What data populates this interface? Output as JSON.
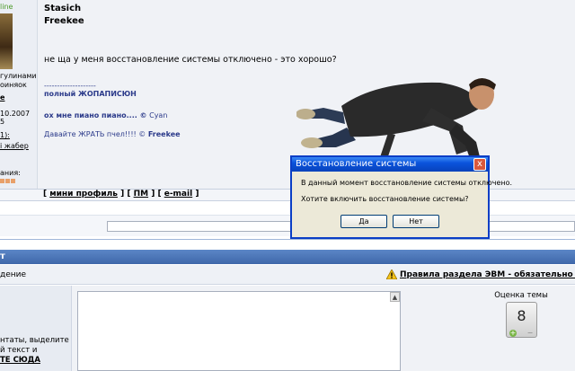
{
  "sidebar": {
    "status": "line",
    "lines": [
      "гулинами",
      "оиняок",
      "е",
      "10.2007",
      "5",
      "1):",
      "і жабер",
      "ания:"
    ]
  },
  "post": {
    "author": "Stasich",
    "group": "Freekee",
    "message": "не ща у меня восстановление системы отключено - это хорошо?",
    "separator": "--------------------",
    "sig_line1": "полный ЖОПАПИСЮН",
    "sig_line2_text": "ох мне пиано пиано.... ©",
    "sig_line2_author": "Cyan",
    "sig_line3_text": "Давайте ЖРАТЬ пчел!!!! ©",
    "sig_line3_author": "Freekee"
  },
  "footer": {
    "links": [
      "мини профиль",
      "ПМ",
      "e-mail"
    ]
  },
  "section_bar": {
    "label": "т"
  },
  "rules_row": {
    "left_label": "дение",
    "rules_link": "Правила раздела ЭВМ - обязательно к о"
  },
  "reply": {
    "hint_line1": "нтаты, выделите",
    "hint_line2": "й текст и",
    "hint_line3": "ТЕ СЮДА"
  },
  "rating": {
    "label": "Оценка темы",
    "value": "8",
    "plus": "+",
    "minus": "−"
  },
  "dialog": {
    "title": "Восстановление системы",
    "close": "x",
    "message": "В данный момент восстановление системы отключено.",
    "question": "Хотите включить восстановление системы?",
    "yes": "Да",
    "no": "Нет"
  },
  "colors": {
    "accent": "#3f67aa",
    "dialog_title": "#0a53dc",
    "signature": "#2b3a8a"
  }
}
